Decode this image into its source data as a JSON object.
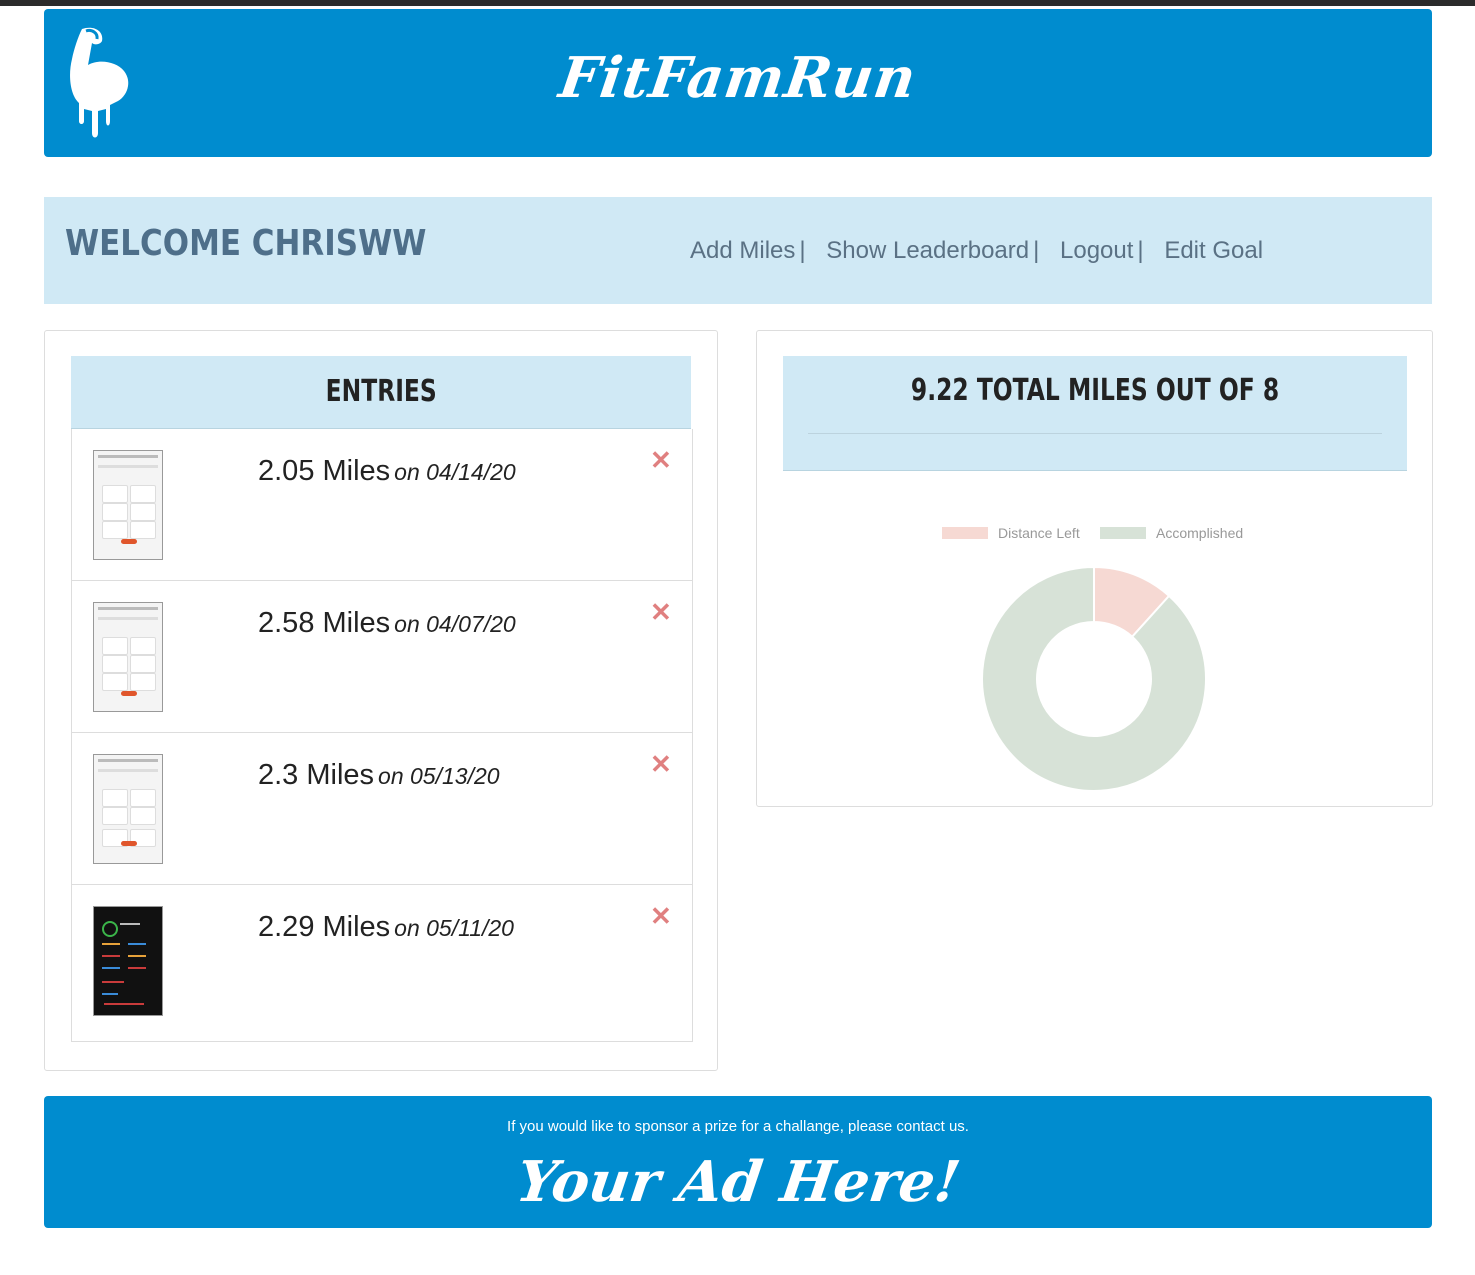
{
  "header": {
    "brand": "FitFamRun",
    "logo_icon": "flexed-arm-icon"
  },
  "welcome": {
    "title": "WELCOME CHRISWW",
    "nav": [
      {
        "label": "Add Miles"
      },
      {
        "label": "Show Leaderboard"
      },
      {
        "label": "Logout"
      },
      {
        "label": "Edit Goal"
      }
    ],
    "separator": "|"
  },
  "entries": {
    "title": "ENTRIES",
    "delete_icon": "close-icon",
    "items": [
      {
        "miles": "2.05 Miles",
        "date": "on 04/14/20"
      },
      {
        "miles": "2.58 Miles",
        "date": "on 04/07/20"
      },
      {
        "miles": "2.3 Miles",
        "date": "on 05/13/20"
      },
      {
        "miles": "2.29 Miles",
        "date": "on 05/11/20"
      }
    ]
  },
  "progress": {
    "title": "9.22 TOTAL MILES OUT OF 8"
  },
  "chart_data": {
    "type": "pie",
    "style": "doughnut",
    "legend_position": "top",
    "categories": [
      "Distance Left",
      "Accomplished"
    ],
    "values": [
      1.22,
      9.22
    ],
    "colors": [
      "#f6d9d3",
      "#d7e2d7"
    ]
  },
  "footer": {
    "sponsor_text": "If you would like to sponsor a prize for a challange, please contact us.",
    "ad_text": "Your Ad Here!"
  }
}
